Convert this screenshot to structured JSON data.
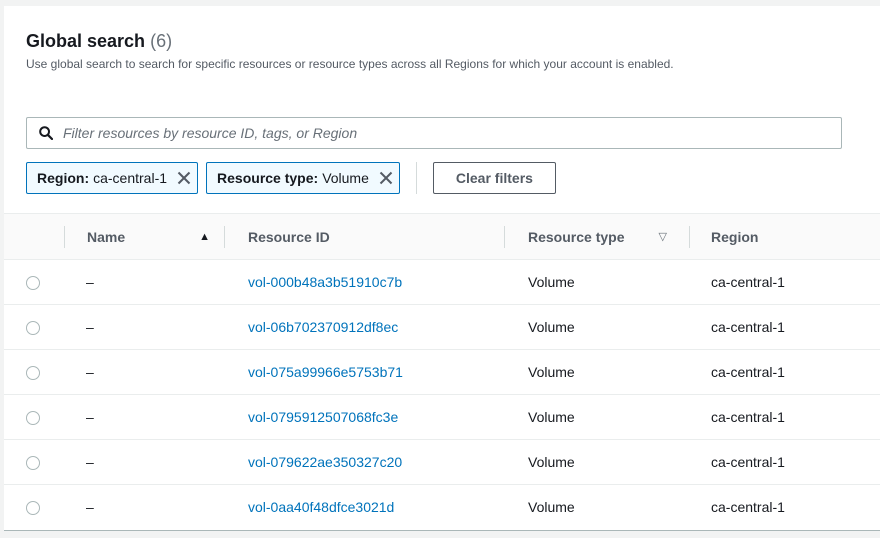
{
  "header": {
    "title": "Global search",
    "count": "(6)",
    "description": "Use global search to search for specific resources or resource types across all Regions for which your account is enabled."
  },
  "search": {
    "placeholder": "Filter resources by resource ID, tags, or Region",
    "value": ""
  },
  "filters": [
    {
      "key": "Region:",
      "value": "ca-central-1"
    },
    {
      "key": "Resource type:",
      "value": "Volume"
    }
  ],
  "clear_filters_label": "Clear filters",
  "table": {
    "columns": {
      "name": "Name",
      "resource_id": "Resource ID",
      "resource_type": "Resource type",
      "region": "Region"
    },
    "sort_asc_icon": "▲",
    "sort_desc_icon": "▽",
    "rows": [
      {
        "name": "–",
        "resource_id": "vol-000b48a3b51910c7b",
        "resource_type": "Volume",
        "region": "ca-central-1"
      },
      {
        "name": "–",
        "resource_id": "vol-06b702370912df8ec",
        "resource_type": "Volume",
        "region": "ca-central-1"
      },
      {
        "name": "–",
        "resource_id": "vol-075a99966e5753b71",
        "resource_type": "Volume",
        "region": "ca-central-1"
      },
      {
        "name": "–",
        "resource_id": "vol-0795912507068fc3e",
        "resource_type": "Volume",
        "region": "ca-central-1"
      },
      {
        "name": "–",
        "resource_id": "vol-079622ae350327c20",
        "resource_type": "Volume",
        "region": "ca-central-1"
      },
      {
        "name": "–",
        "resource_id": "vol-0aa40f48dfce3021d",
        "resource_type": "Volume",
        "region": "ca-central-1"
      }
    ]
  },
  "colors": {
    "link": "#0073bb",
    "token_border": "#0073bb",
    "token_bg": "#f1faff"
  }
}
